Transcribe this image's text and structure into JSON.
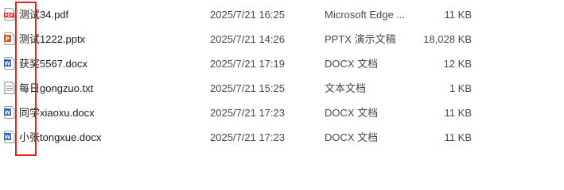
{
  "files": [
    {
      "icon": "pdf-file-icon",
      "name": "测试34.pdf",
      "date": "2025/7/21 16:25",
      "type": "Microsoft Edge ...",
      "size": "11 KB"
    },
    {
      "icon": "pptx-file-icon",
      "name": "测试1222.pptx",
      "date": "2025/7/21 14:26",
      "type": "PPTX 演示文稿",
      "size": "18,028 KB"
    },
    {
      "icon": "docx-file-icon",
      "name": "获奖5567.docx",
      "date": "2025/7/21 17:19",
      "type": "DOCX 文档",
      "size": "12 KB"
    },
    {
      "icon": "txt-file-icon",
      "name": "每日gongzuo.txt",
      "date": "2025/7/21 15:25",
      "type": "文本文档",
      "size": "1 KB"
    },
    {
      "icon": "docx-file-icon",
      "name": "同学xiaoxu.docx",
      "date": "2025/7/21 17:23",
      "type": "DOCX 文档",
      "size": "11 KB"
    },
    {
      "icon": "docx-file-icon",
      "name": "小张tongxue.docx",
      "date": "2025/7/21 17:23",
      "type": "DOCX 文档",
      "size": "11 KB"
    }
  ],
  "colors": {
    "pdf": "#e02020",
    "pptx": "#d9532c",
    "docx": "#2b5faa",
    "txt": "#8a8a8a",
    "highlight": "#e2231a"
  }
}
